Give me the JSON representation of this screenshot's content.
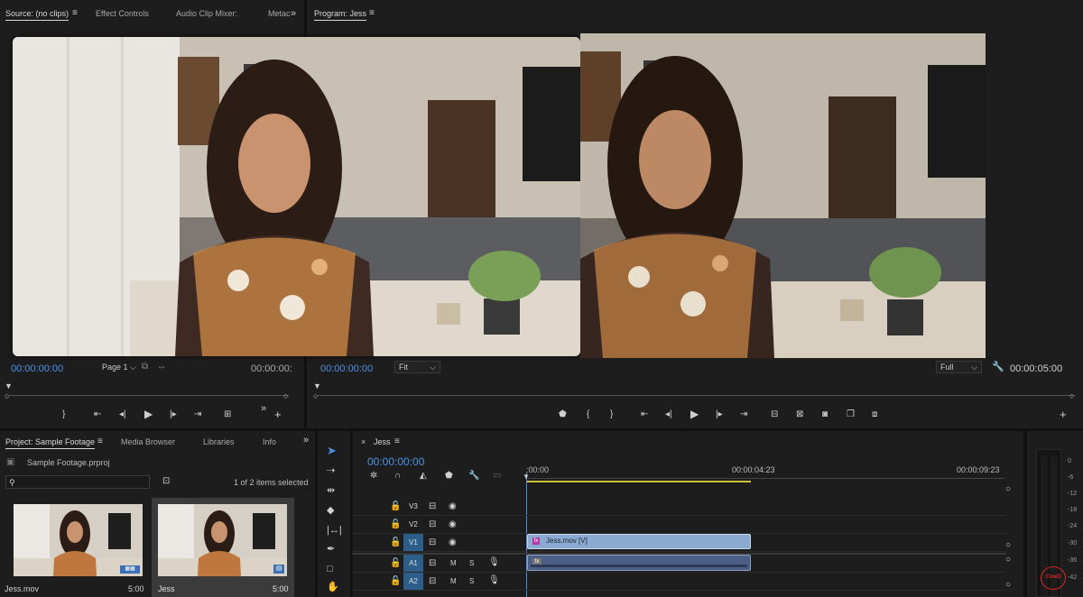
{
  "source_panel": {
    "tabs": [
      "Source: (no clips)",
      "Effect Controls",
      "Audio Clip Mixer:",
      "Metac"
    ],
    "timecode_left": "00:00:00:00",
    "page_dropdown": "Page 1",
    "timecode_right": "00:00:00:"
  },
  "program_panel": {
    "title": "Program: Jess",
    "timecode_left": "00:00:00:00",
    "fit_dropdown": "Fit",
    "quality_dropdown": "Full",
    "timecode_right": "00:00:05:00"
  },
  "project_panel": {
    "tabs": [
      "Project: Sample Footage",
      "Media Browser",
      "Libraries",
      "Info"
    ],
    "project_file": "Sample Footage.prproj",
    "search_placeholder": "",
    "selection_status": "1 of 2 items selected",
    "items": [
      {
        "name": "Jess.mov",
        "duration": "5:00"
      },
      {
        "name": "Jess",
        "duration": "5:00"
      }
    ]
  },
  "timeline_panel": {
    "sequence_name": "Jess",
    "timecode": "00:00:00:00",
    "ruler_labels": [
      ":00:00",
      "00:00:04:23",
      "00:00:09:23"
    ],
    "video_tracks": [
      "V3",
      "V2",
      "V1"
    ],
    "audio_tracks": [
      "A1",
      "A2"
    ],
    "audio_mute": "M",
    "audio_solo": "S",
    "clip_video_label": "Jess.mov [V]"
  },
  "audio_meter": {
    "labels": [
      "0",
      "-6",
      "-12",
      "-18",
      "-24",
      "-30",
      "-36",
      "-42"
    ],
    "badge": "CineD"
  },
  "colors": {
    "accent_blue": "#4c8fe4",
    "clip_video": "#8aaad2",
    "clip_audio": "#4a5e86",
    "playhead_work_area": "#c9c23a",
    "badge_red": "#d62828"
  }
}
